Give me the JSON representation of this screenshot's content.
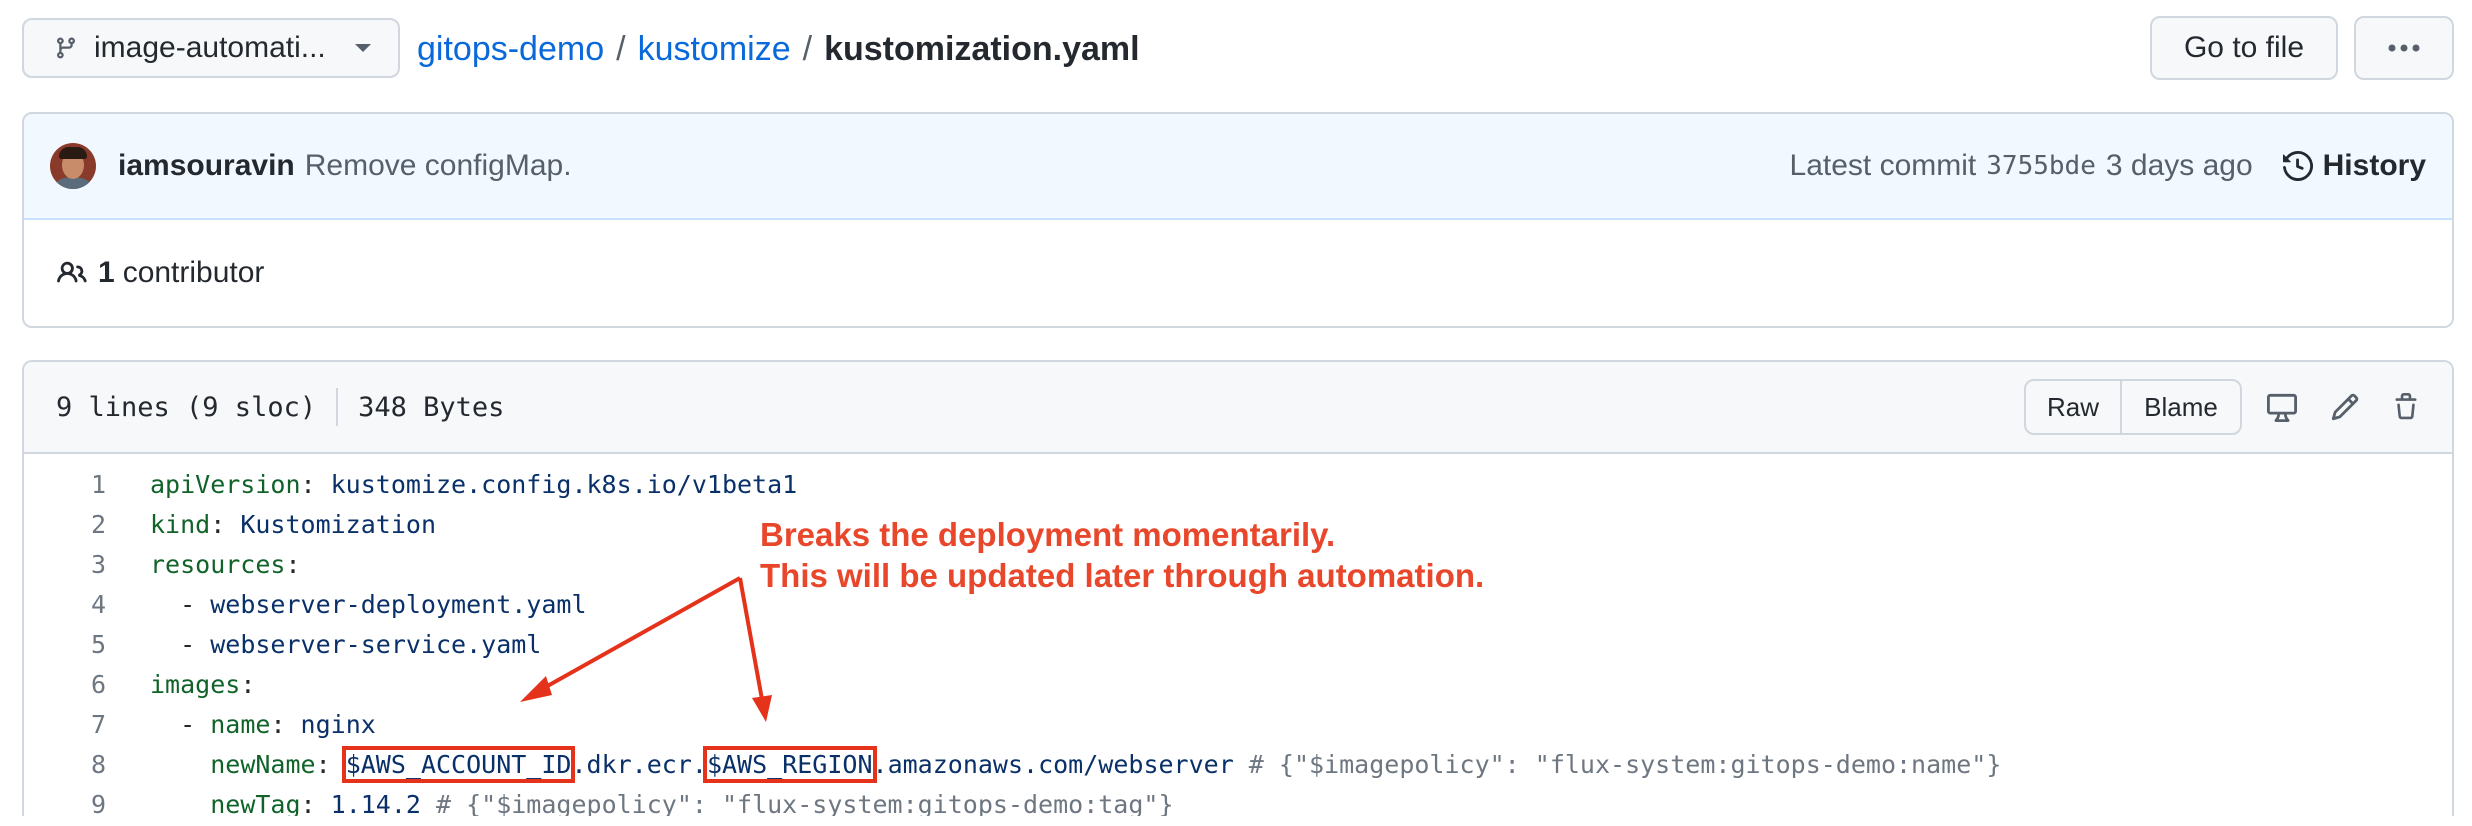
{
  "branch": {
    "name": "image-automati..."
  },
  "breadcrumb": {
    "repo": "gitops-demo",
    "folder": "kustomize",
    "file": "kustomization.yaml",
    "sep1": "/",
    "sep2": "/"
  },
  "actions": {
    "goto_file": "Go to file"
  },
  "commit": {
    "author": "iamsouravin",
    "message": "Remove configMap.",
    "latest_label": "Latest commit",
    "hash": "3755bde",
    "time": "3 days ago",
    "history_label": "History"
  },
  "contributors": {
    "count": "1",
    "label": "contributor"
  },
  "file": {
    "lines_info": "9 lines (9 sloc)",
    "size": "348 Bytes",
    "raw_label": "Raw",
    "blame_label": "Blame"
  },
  "code": {
    "l1": {
      "num": "1",
      "key": "apiVersion",
      "colon": ": ",
      "value": "kustomize.config.k8s.io/v1beta1"
    },
    "l2": {
      "num": "2",
      "key": "kind",
      "colon": ": ",
      "value": "Kustomization"
    },
    "l3": {
      "num": "3",
      "key": "resources",
      "colon": ":"
    },
    "l4": {
      "num": "4",
      "dash": "  - ",
      "value": "webserver-deployment.yaml"
    },
    "l5": {
      "num": "5",
      "dash": "  - ",
      "value": "webserver-service.yaml"
    },
    "l6": {
      "num": "6",
      "key": "images",
      "colon": ":"
    },
    "l7": {
      "num": "7",
      "dash": "  - ",
      "key": "name",
      "colon": ": ",
      "value": "nginx"
    },
    "l8": {
      "num": "8",
      "indent": "    ",
      "key": "newName",
      "colon": ": ",
      "account": "$AWS_ACCOUNT_ID",
      "mid": ".dkr.ecr.",
      "region": "$AWS_REGION",
      "rest": ".amazonaws.com/webserver",
      "comment": " # {\"$imagepolicy\": \"flux-system:gitops-demo:name\"}"
    },
    "l9": {
      "num": "9",
      "indent": "    ",
      "key": "newTag",
      "colon": ": ",
      "value": "1.14.2",
      "comment": " # {\"$imagepolicy\": \"flux-system:gitops-demo:tag\"}"
    }
  },
  "annotation": {
    "line1": "Breaks the deployment momentarily.",
    "line2": "This will be updated later through automation.",
    "color": "#e8472c"
  },
  "colors": {
    "link": "#0969da",
    "key": "#116329",
    "value": "#0a3069",
    "comment": "#6e7781",
    "highlight": "#e5321b"
  },
  "icons": [
    "git-branch-icon",
    "caret-down-icon",
    "kebab-horizontal-icon",
    "history-icon",
    "people-icon",
    "desktop-icon",
    "pencil-icon",
    "trash-icon"
  ]
}
